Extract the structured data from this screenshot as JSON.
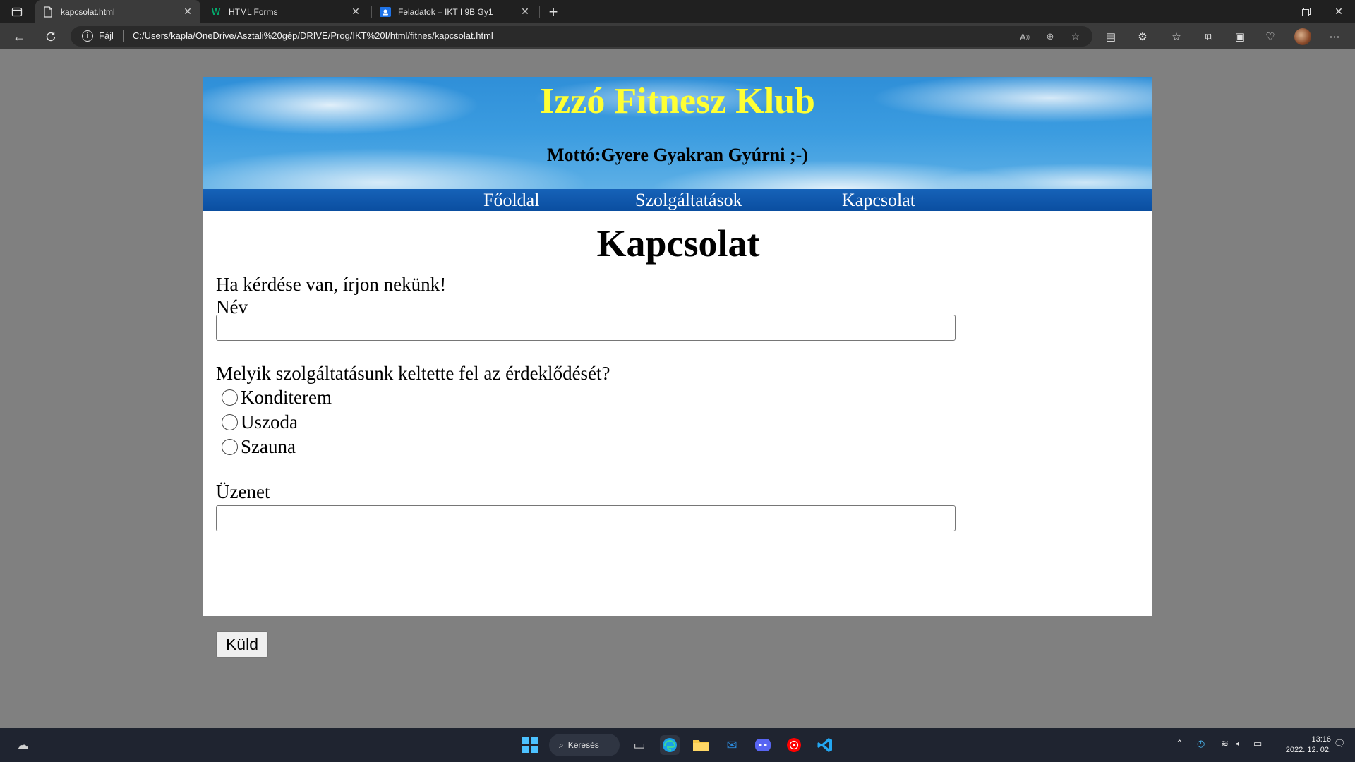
{
  "browser": {
    "tabs": [
      {
        "title": "kapcsolat.html",
        "icon": "page-icon",
        "active": true
      },
      {
        "title": "HTML Forms",
        "icon": "w3schools-icon",
        "active": false
      },
      {
        "title": "Feladatok – IKT I 9B Gy1",
        "icon": "classroom-icon",
        "active": false
      }
    ],
    "address": {
      "scheme_label": "Fájl",
      "url": "C:/Users/kapla/OneDrive/Asztali%20gép/DRIVE/Prog/IKT%20I/html/fitnes/kapcsolat.html"
    }
  },
  "page": {
    "site_title": "Izzó Fitnesz Klub",
    "motto": "Mottó:Gyere Gyakran Gyúrni ;-)",
    "menu": [
      "Főoldal",
      "Szolgáltatások",
      "Kapcsolat"
    ],
    "heading": "Kapcsolat",
    "intro": "Ha kérdése van, írjon nekünk!",
    "name_label": "Név",
    "name_value": "",
    "service_question": "Melyik szolgáltatásunk keltette fel az érdeklődését?",
    "services": [
      "Konditerem",
      "Uszoda",
      "Szauna"
    ],
    "message_label": "Üzenet",
    "message_value": "",
    "submit_label": "Küld"
  },
  "taskbar": {
    "search_label": "Keresés",
    "time": "13:16",
    "date": "2022. 12. 02."
  },
  "colors": {
    "title_yellow": "#ffff33",
    "menu_blue": "#0a4ea0",
    "page_background": "#808080"
  }
}
